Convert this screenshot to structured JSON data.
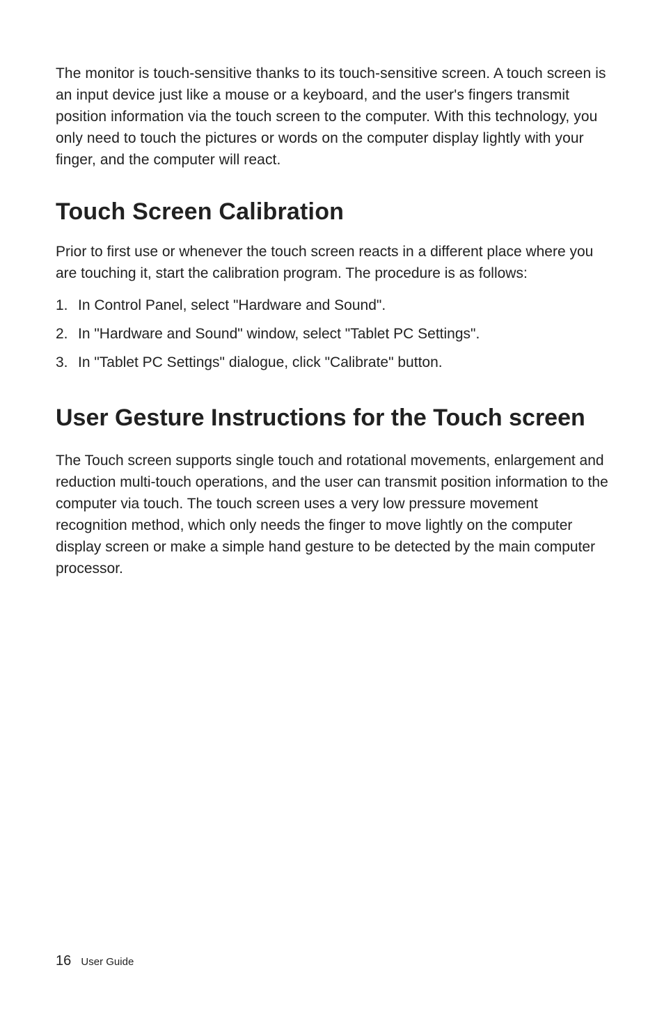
{
  "intro_paragraph": "The monitor is touch-sensitive thanks to its touch-sensitive screen. A touch screen is an input device just like a mouse or a keyboard, and the user's fingers transmit position information via the touch screen to the computer. With this technology, you only need to touch the pictures or words on the computer display lightly with your finger, and the computer will react.",
  "section1": {
    "title": "Touch Screen Calibration",
    "intro": "Prior to first use or whenever the touch screen reacts in a different place where you are touching it, start the calibration program. The procedure is as follows:",
    "steps": [
      {
        "num": "1.",
        "text": "In Control Panel, select \"Hardware and Sound\"."
      },
      {
        "num": "2.",
        "text": "In \"Hardware and Sound\" window, select \"Tablet PC Settings\"."
      },
      {
        "num": "3.",
        "text": "In \"Tablet PC Settings\" dialogue, click \"Calibrate\" button."
      }
    ]
  },
  "section2": {
    "title": "User Gesture Instructions for the Touch screen",
    "body": "The Touch screen supports single touch and rotational movements, enlargement and reduction multi-touch operations, and the user can transmit position information to the computer via touch. The touch screen uses a very low pressure movement recognition method, which only needs the finger to move lightly on the computer display screen or make a simple hand gesture to be detected by the main computer processor."
  },
  "footer": {
    "page_number": "16",
    "label": "User Guide"
  }
}
